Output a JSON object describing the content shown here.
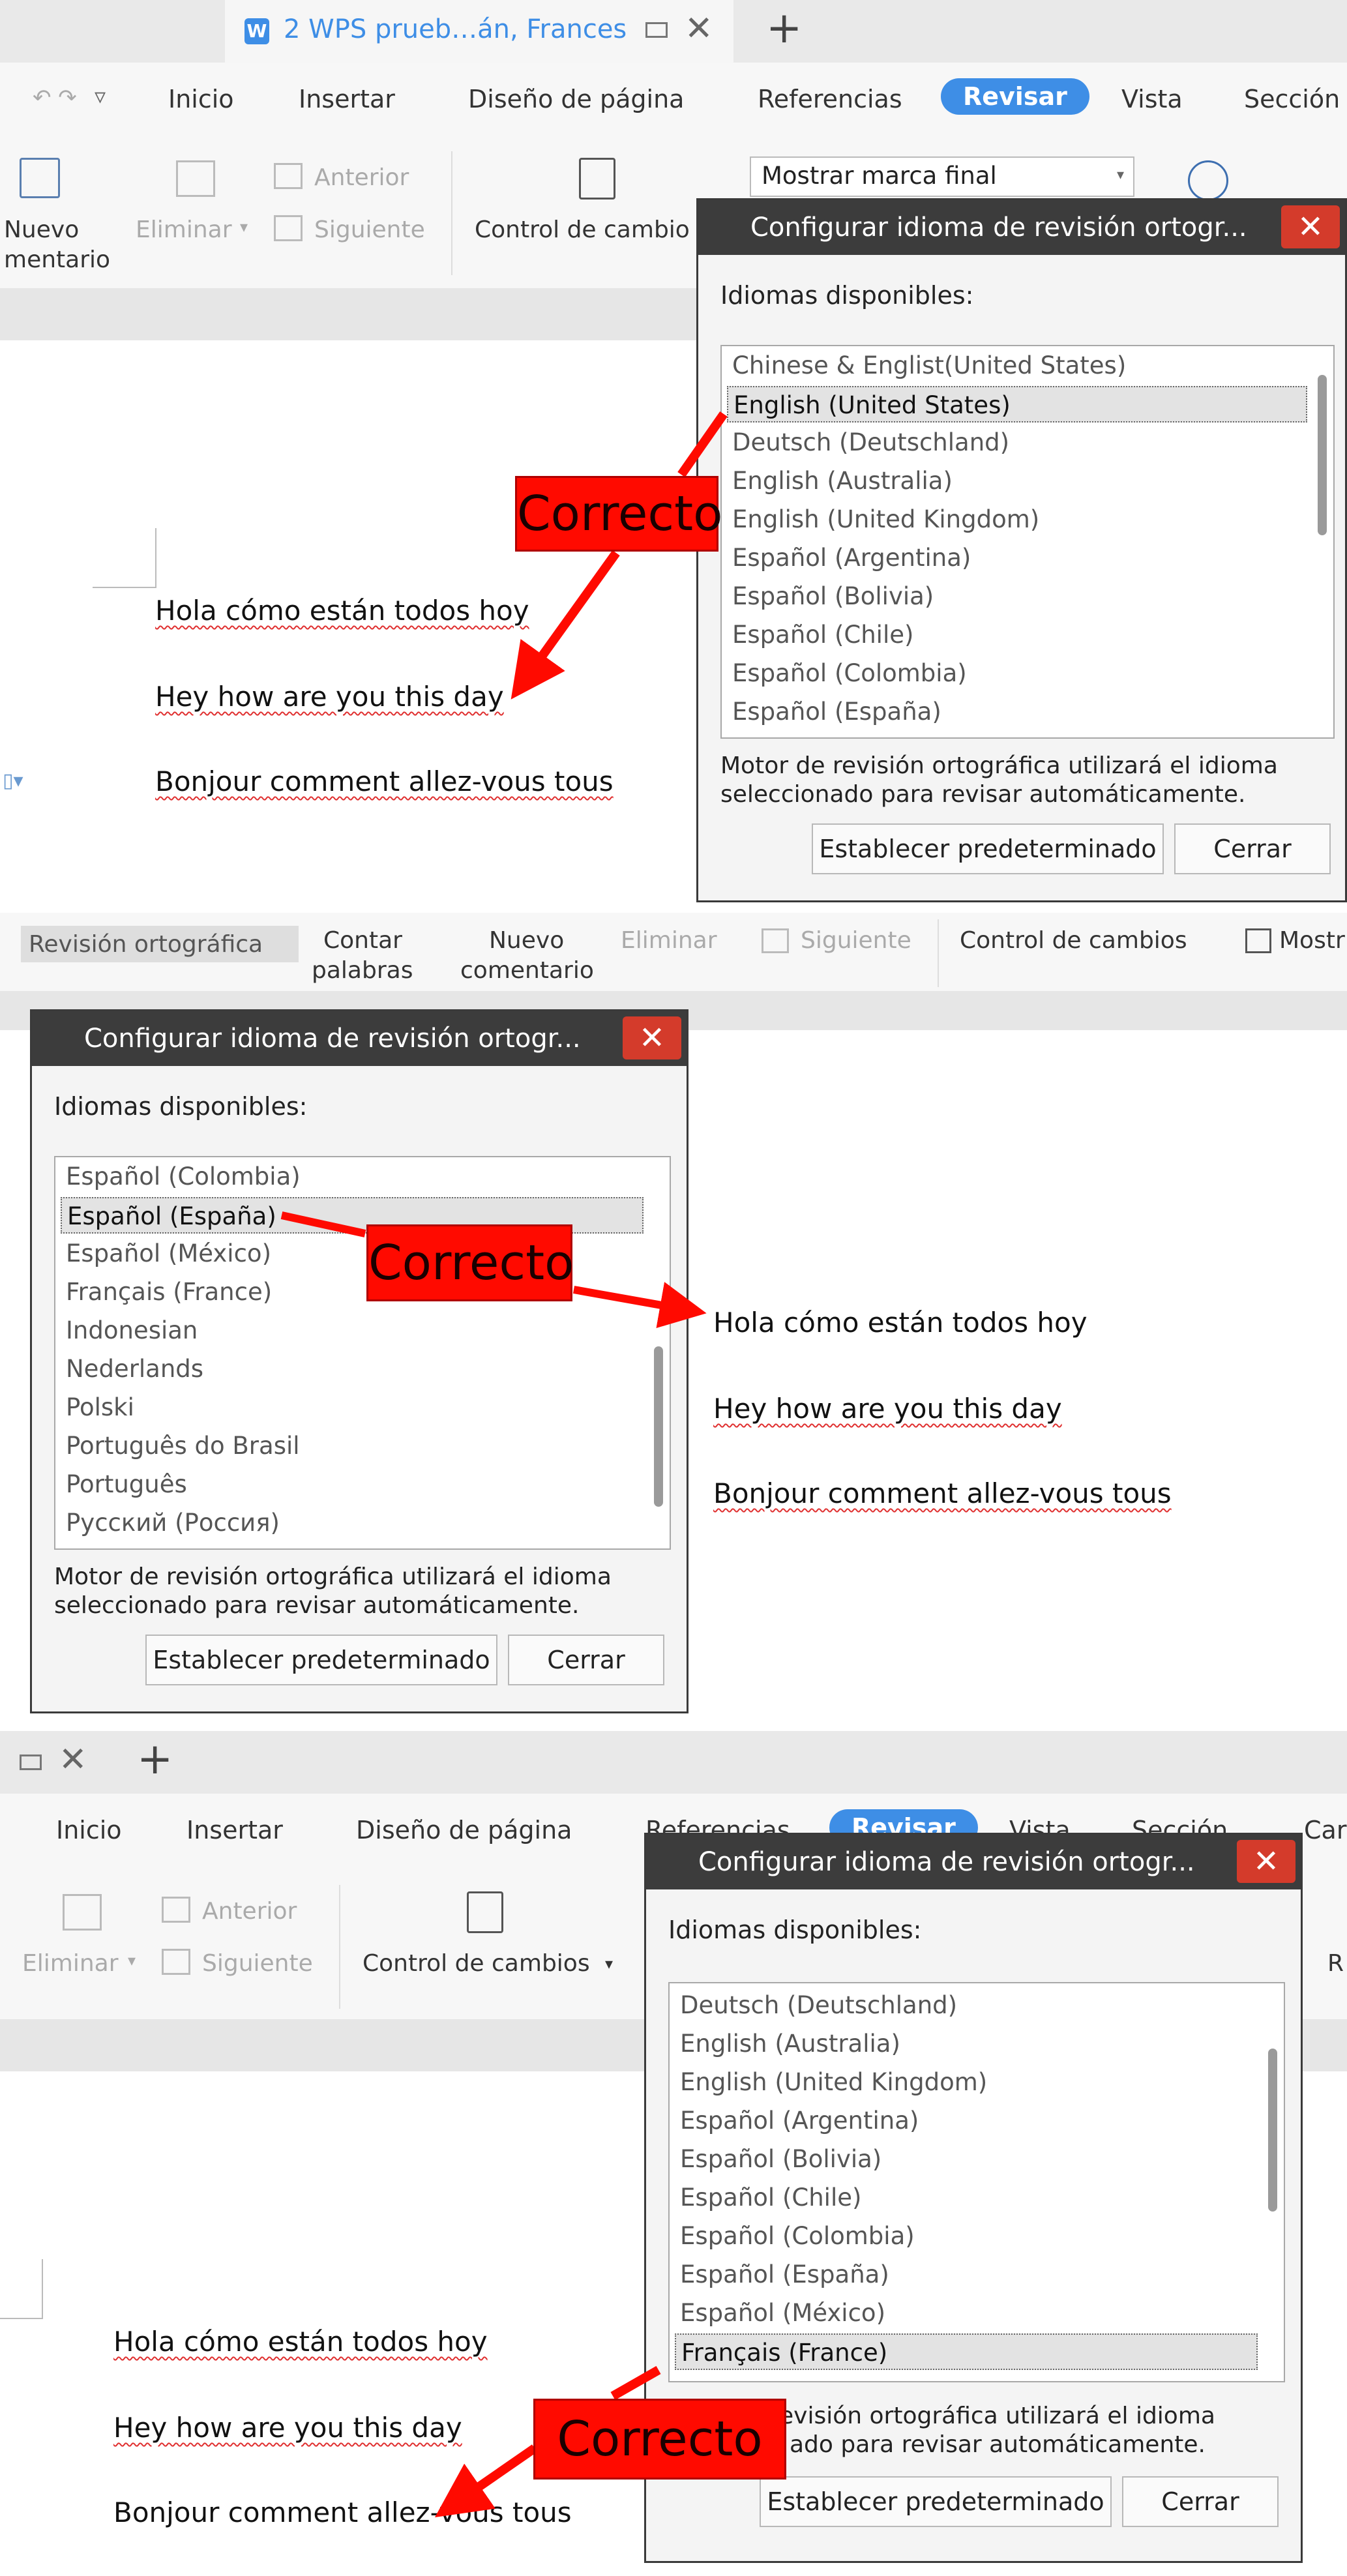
{
  "panel1": {
    "tab_title": "2 WPS prueb…án, Frances",
    "menu": [
      "Inicio",
      "Insertar",
      "Diseño de página",
      "Referencias",
      "Revisar",
      "Vista",
      "Sección"
    ],
    "tools": {
      "new_comment": "Nuevo",
      "new_comment_2": "mentario",
      "delete": "Eliminar",
      "previous": "Anterior",
      "next": "Siguiente",
      "track_changes": "Control de cambio",
      "markup_select": "Mostrar marca final"
    },
    "doc_lines": [
      "Hola cómo están todos hoy",
      "Hey how are you this day",
      "Bonjour comment allez-vous tous"
    ],
    "dialog": {
      "title": "Configurar idioma de revisión ortogr...",
      "available_label": "Idiomas disponibles:",
      "languages": [
        "Chinese & Englist(United States)",
        "English (United States)",
        "Deutsch (Deutschland)",
        "English (Australia)",
        "English (United Kingdom)",
        "Español (Argentina)",
        "Español (Bolivia)",
        "Español (Chile)",
        "Español (Colombia)",
        "Español (España)"
      ],
      "selected_index": 1,
      "desc_line1": "Motor de revisión ortográfica utilizará el idioma",
      "desc_line2": "seleccionado para revisar automáticamente.",
      "set_default": "Establecer predeterminado",
      "close": "Cerrar"
    },
    "callout": "Correcto"
  },
  "panel2": {
    "tools": {
      "spell_check": "Revisión ortográfica",
      "count": "Contar",
      "count_2": "palabras",
      "new": "Nuevo",
      "new_2": "comentario",
      "delete": "Eliminar",
      "next": "Siguiente",
      "track_changes": "Control de cambios",
      "show": "Mostr"
    },
    "dialog": {
      "title": "Configurar idioma de revisión ortogr...",
      "available_label": "Idiomas disponibles:",
      "languages": [
        "Español (Colombia)",
        "Español (España)",
        "Español (México)",
        "Français (France)",
        "Indonesian",
        "Nederlands",
        "Polski",
        "Português do Brasil",
        "Português",
        "Русский (Россия)"
      ],
      "selected_index": 1,
      "desc_line1": "Motor de revisión ortográfica utilizará el idioma",
      "desc_line2": "seleccionado para revisar automáticamente.",
      "set_default": "Establecer predeterminado",
      "close": "Cerrar"
    },
    "doc_lines": [
      "Hola cómo están todos hoy",
      "Hey how are you this day",
      "Bonjour comment allez-vous tous"
    ],
    "callout": "Correcto"
  },
  "panel3": {
    "menu": [
      "Inicio",
      "Insertar",
      "Diseño de página",
      "Referencias",
      "Revisar",
      "Vista",
      "Sección",
      "Car"
    ],
    "tools": {
      "delete": "Eliminar",
      "previous": "Anterior",
      "next": "Siguiente",
      "track_changes": "Control de cambios",
      "r": "R"
    },
    "dialog": {
      "title": "Configurar idioma de revisión ortogr...",
      "available_label": "Idiomas disponibles:",
      "languages": [
        "Deutsch (Deutschland)",
        "English (Australia)",
        "English (United Kingdom)",
        "Español (Argentina)",
        "Español (Bolivia)",
        "Español (Chile)",
        "Español (Colombia)",
        "Español (España)",
        "Español (México)",
        "Français (France)"
      ],
      "selected_index": 9,
      "desc_line1": "revisión ortográfica utilizará el idioma",
      "desc_line2": "ado para revisar automáticamente.",
      "set_default": "Establecer predeterminado",
      "close": "Cerrar"
    },
    "doc_lines": [
      "Hola cómo están todos hoy",
      "Hey how are you this day",
      "Bonjour comment allez-vous tous"
    ],
    "callout": "Correcto"
  },
  "colors": {
    "accent": "#3e8ee6",
    "callout": "#ff0a00",
    "close_button": "#d43b2b",
    "dialog_title": "#3c3c3c"
  },
  "icons": [
    "document-tab-icon",
    "close-icon",
    "plus-icon",
    "new-comment-icon",
    "delete-comment-icon",
    "track-changes-icon",
    "chevron-down-icon"
  ]
}
